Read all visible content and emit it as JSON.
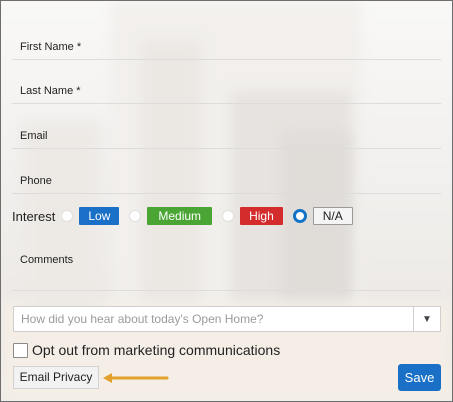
{
  "form": {
    "fields": [
      {
        "label": "First Name *"
      },
      {
        "label": "Last Name *"
      },
      {
        "label": "Email"
      },
      {
        "label": "Phone"
      }
    ],
    "interest": {
      "label": "Interest",
      "options": [
        "Low",
        "Medium",
        "High",
        "N/A"
      ],
      "selected": "N/A"
    },
    "comments_label": "Comments",
    "source_placeholder": "How did you hear about today's Open Home?",
    "optout_label": "Opt out from marketing communications",
    "privacy_button": "Email Privacy",
    "save_button": "Save"
  },
  "colors": {
    "low": "#1a70c6",
    "medium": "#4aa535",
    "high": "#d42c2c",
    "accent": "#1a70c6",
    "arrow": "#e2a12a"
  },
  "icons": [
    "dropdown-caret-icon",
    "arrow-left-icon"
  ]
}
